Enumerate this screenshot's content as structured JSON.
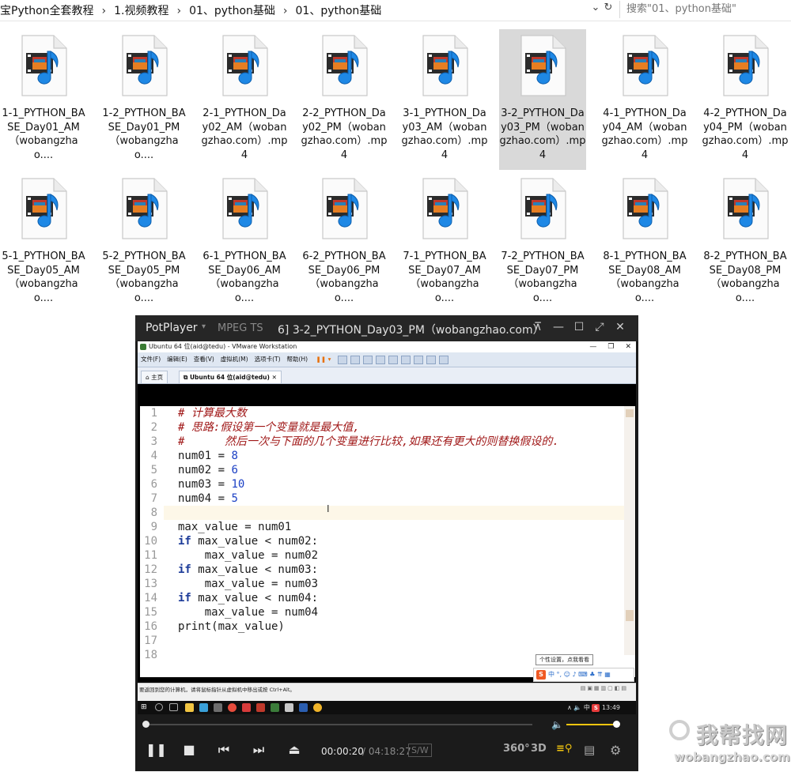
{
  "explorer": {
    "breadcrumb": [
      "宝Python全套教程",
      "1.视频教程",
      "01、python基础",
      "01、python基础"
    ],
    "search_placeholder": "搜索\"01、python基础\"",
    "files": [
      {
        "label": "1-1_PYTHON_BASE_Day01_AM（wobangzhao....",
        "selected": false
      },
      {
        "label": "1-2_PYTHON_BASE_Day01_PM（wobangzhao....",
        "selected": false
      },
      {
        "label": "2-1_PYTHON_Day02_AM（wobangzhao.com）.mp4",
        "selected": false
      },
      {
        "label": "2-2_PYTHON_Day02_PM（wobangzhao.com）.mp4",
        "selected": false
      },
      {
        "label": "3-1_PYTHON_Day03_AM（wobangzhao.com）.mp4",
        "selected": false
      },
      {
        "label": "3-2_PYTHON_Day03_PM（wobangzhao.com）.mp4",
        "selected": true
      },
      {
        "label": "4-1_PYTHON_Day04_AM（wobangzhao.com）.mp4",
        "selected": false
      },
      {
        "label": "4-2_PYTHON_Day04_PM（wobangzhao.com）.mp4",
        "selected": false
      },
      {
        "label": "5-1_PYTHON_BASE_Day05_AM（wobangzhao....",
        "selected": false
      },
      {
        "label": "5-2_PYTHON_BASE_Day05_PM（wobangzhao....",
        "selected": false
      },
      {
        "label": "6-1_PYTHON_BASE_Day06_AM（wobangzhao....",
        "selected": false
      },
      {
        "label": "6-2_PYTHON_BASE_Day06_PM（wobangzhao....",
        "selected": false
      },
      {
        "label": "7-1_PYTHON_BASE_Day07_AM（wobangzhao....",
        "selected": false
      },
      {
        "label": "7-2_PYTHON_BASE_Day07_PM（wobangzhao....",
        "selected": false
      },
      {
        "label": "8-1_PYTHON_BASE_Day08_AM（wobangzhao....",
        "selected": false
      },
      {
        "label": "8-2_PYTHON_BASE_Day08_PM（wobangzhao....",
        "selected": false
      }
    ]
  },
  "player": {
    "brand": "PotPlayer",
    "format": "MPEG TS",
    "title": "6] 3-2_PYTHON_Day03_PM（wobangzhao.com）",
    "current_time": "00:00:20",
    "total_time": "/ 04:18:27",
    "sw_label": "S/W",
    "btn_360": "360°",
    "btn_3d": "3D",
    "progress_fraction": 0.0013,
    "volume_fraction": 0.95,
    "accent_color": "#f1c40f"
  },
  "vmware": {
    "window_title": "Ubuntu 64 位(aid@tedu) - VMware Workstation",
    "menu": [
      "文件(F)",
      "编辑(E)",
      "查看(V)",
      "虚拟机(M)",
      "选项卡(T)",
      "帮助(H)"
    ],
    "tabs": [
      "主页",
      "Ubuntu 64 位(aid@tedu)"
    ],
    "status_text": "要返回到您的计算机，请将鼠标指针从虚拟机中移出或按 Ctrl+Alt。",
    "ime_tip": "个性设置，点我看看",
    "ime_bar": "中 °, ☺ ♪ ⌨ ♣ ⇈ ▦",
    "ime_logo": "S",
    "tray_text": "∧ 🔈 中",
    "tray_logo": "S",
    "clock": "13:49"
  },
  "editor": {
    "line_numbers": [
      "1",
      "2",
      "3",
      "4",
      "5",
      "6",
      "7",
      "8",
      "9",
      "10",
      "11",
      "12",
      "13",
      "14",
      "15",
      "16",
      "17",
      "18"
    ],
    "lines": [
      {
        "kind": "comment",
        "text": "# 计算最大数"
      },
      {
        "kind": "comment",
        "text": "# 思路:假设第一个变量就是最大值,"
      },
      {
        "kind": "comment",
        "text": "#      然后一次与下面的几个变量进行比较,如果还有更大的则替换假设的."
      },
      {
        "kind": "code",
        "pre": "num01 = ",
        "num": "8"
      },
      {
        "kind": "code",
        "pre": "num02 = ",
        "num": "6"
      },
      {
        "kind": "code",
        "pre": "num03 = ",
        "num": "10"
      },
      {
        "kind": "code",
        "pre": "num04 = ",
        "num": "5"
      },
      {
        "kind": "code",
        "pre": "",
        "num": ""
      },
      {
        "kind": "code",
        "pre": "max_value = num01",
        "num": ""
      },
      {
        "kind": "if",
        "kw": "if",
        "rest": " max_value < num02:"
      },
      {
        "kind": "code",
        "pre": "    max_value = num02",
        "num": ""
      },
      {
        "kind": "if",
        "kw": "if",
        "rest": " max_value < num03:"
      },
      {
        "kind": "code",
        "pre": "    max_value = num03",
        "num": ""
      },
      {
        "kind": "if",
        "kw": "if",
        "rest": " max_value < num04:"
      },
      {
        "kind": "code",
        "pre": "    max_value = num04",
        "num": ""
      },
      {
        "kind": "code",
        "pre": "print(max_value)",
        "num": ""
      },
      {
        "kind": "code",
        "pre": "",
        "num": ""
      },
      {
        "kind": "code",
        "pre": "",
        "num": ""
      }
    ]
  },
  "watermark": {
    "big": "我帮找网",
    "small": "wobangzhao.com"
  }
}
